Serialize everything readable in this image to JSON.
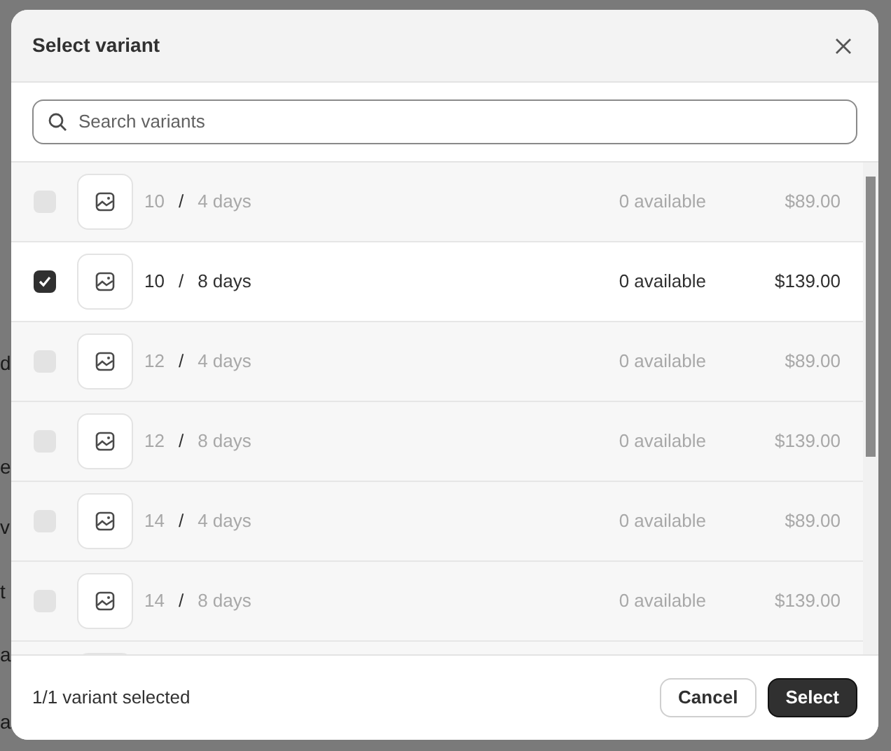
{
  "background": {
    "texts": [
      "d",
      "e",
      "v",
      "t",
      "a",
      "a"
    ]
  },
  "dialog": {
    "title": "Select variant",
    "search": {
      "placeholder": "Search variants"
    },
    "variants": [
      {
        "size": "10",
        "separator": "/",
        "duration": "4 days",
        "availability": "0 available",
        "price": "$89.00",
        "checked": false,
        "disabled": true
      },
      {
        "size": "10",
        "separator": "/",
        "duration": "8 days",
        "availability": "0 available",
        "price": "$139.00",
        "checked": true,
        "disabled": false
      },
      {
        "size": "12",
        "separator": "/",
        "duration": "4 days",
        "availability": "0 available",
        "price": "$89.00",
        "checked": false,
        "disabled": true
      },
      {
        "size": "12",
        "separator": "/",
        "duration": "8 days",
        "availability": "0 available",
        "price": "$139.00",
        "checked": false,
        "disabled": true
      },
      {
        "size": "14",
        "separator": "/",
        "duration": "4 days",
        "availability": "0 available",
        "price": "$89.00",
        "checked": false,
        "disabled": true
      },
      {
        "size": "14",
        "separator": "/",
        "duration": "8 days",
        "availability": "0 available",
        "price": "$139.00",
        "checked": false,
        "disabled": true
      }
    ],
    "status": "1/1 variant selected",
    "buttons": [
      {
        "label": "Cancel",
        "kind": "secondary"
      },
      {
        "label": "Select",
        "kind": "primary"
      }
    ]
  }
}
